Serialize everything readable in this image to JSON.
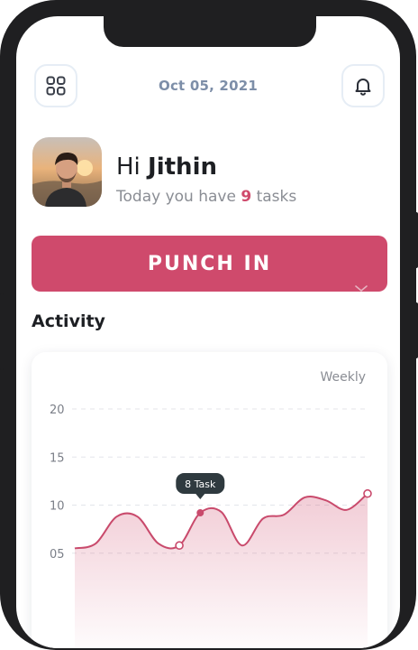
{
  "header": {
    "date": "Oct 05, 2021",
    "menu_icon": "grid-icon",
    "notification_icon": "bell-icon"
  },
  "profile": {
    "greeting_prefix": "Hi",
    "name": "Jithin",
    "tasks_prefix": "Today you have",
    "task_count": "9",
    "tasks_suffix": "tasks"
  },
  "punch_button": {
    "label": "PUNCH IN"
  },
  "activity": {
    "title": "Activity",
    "period": "Weekly"
  },
  "colors": {
    "accent": "#cf4a6c",
    "date_text": "#7d8ea8",
    "frame": "#1f1f21"
  },
  "chart_data": {
    "type": "area",
    "y_ticks": [
      "20",
      "15",
      "10",
      "05"
    ],
    "ylim": [
      0,
      20
    ],
    "grid": true,
    "x": [
      0,
      1,
      2,
      3,
      4,
      5,
      6,
      7,
      8,
      9,
      10,
      11,
      12,
      13,
      14
    ],
    "values": [
      5.5,
      6.0,
      8.8,
      8.8,
      6.0,
      5.8,
      9.2,
      9.3,
      5.8,
      8.6,
      9.0,
      10.8,
      10.5,
      9.5,
      11.2
    ],
    "markers": [
      {
        "x": 5,
        "y": 5.8,
        "style": "hollow"
      },
      {
        "x": 6,
        "y": 9.2,
        "style": "filled"
      },
      {
        "x": 14,
        "y": 11.2,
        "style": "hollow"
      }
    ],
    "tooltip": {
      "label": "8 Task",
      "x": 6
    }
  }
}
